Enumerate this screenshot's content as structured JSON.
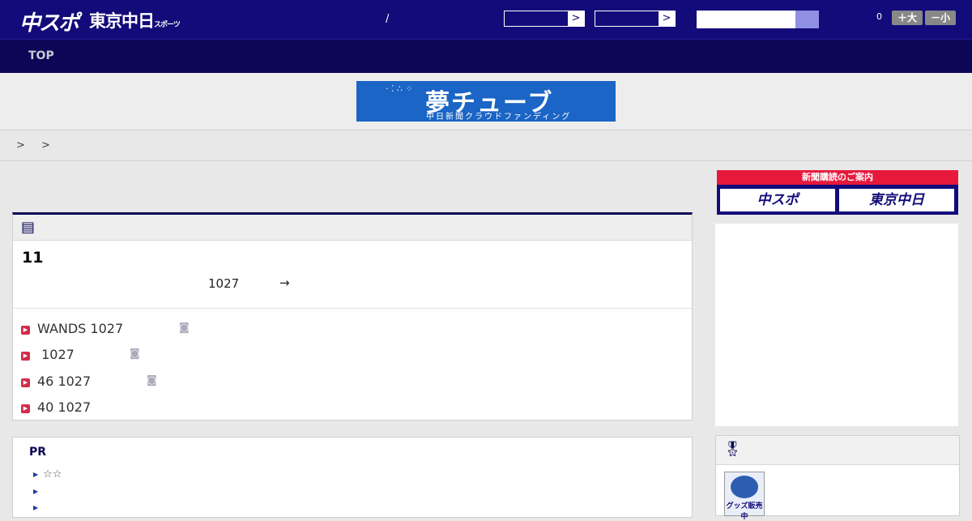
{
  "header": {
    "logo_chuspo": "中スポ",
    "logo_tokyo": "東京中日",
    "logo_tokyo_sub": "スポーツ",
    "slash": "/",
    "select1_arrow": ">",
    "select2_arrow": ">",
    "search_placeholder": "",
    "count": "0",
    "font_plus": "＋大",
    "font_minus": "－小"
  },
  "nav": {
    "top_label": "TOP"
  },
  "banner": {
    "title": "夢チューブ",
    "subtitle": "中日新聞クラウドファンディング",
    "dots": "· ⁚ ∴ ⁘"
  },
  "breadcrumb": "> >",
  "article": {
    "title": "11",
    "date": "1027",
    "more": "→",
    "related": [
      {
        "text": "WANDS 1027",
        "has_photo": true
      },
      {
        "text": " 1027",
        "has_photo": true
      },
      {
        "text": "46 1027",
        "has_photo": true
      },
      {
        "text": "40 1027",
        "has_photo": false
      }
    ]
  },
  "pr": {
    "heading": "PR",
    "items": [
      "☆☆",
      "",
      ""
    ]
  },
  "sidebar": {
    "subscribe_title": "新聞購読のご案内",
    "subscribe_logo1": "中スポ",
    "subscribe_logo2": "東京中日",
    "goods_label": "グッズ販売中"
  },
  "colors": {
    "header_bg": "#130b7a",
    "nav_bg": "#0b0655",
    "accent_red": "#e6193c",
    "banner_blue": "#1a65c5"
  },
  "icons": {
    "article_icon": "newspaper-icon",
    "ranking_icon": "medal-icon",
    "photo_icon": "camera-icon"
  }
}
